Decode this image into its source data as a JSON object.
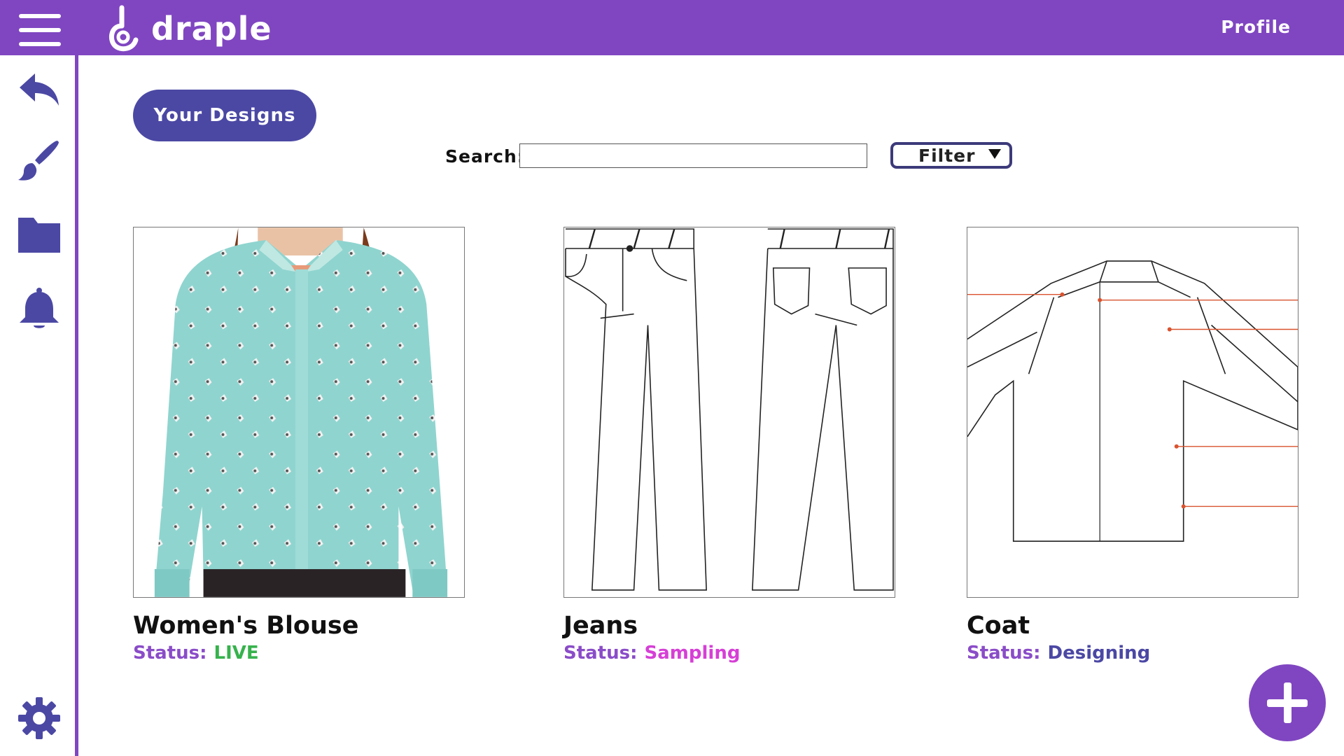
{
  "app": {
    "logo_text": "draple",
    "profile_label": "Profile"
  },
  "colors": {
    "brand": "#8046c1",
    "button": "#4b48a4",
    "icon": "#4b48a4",
    "status_live": "#37b24d",
    "status_sampling": "#d63fd6",
    "status_designing": "#4b48a4"
  },
  "sidebar": {
    "icons": [
      "back-arrow-icon",
      "paintbrush-icon",
      "folder-icon",
      "bell-icon",
      "gear-icon"
    ]
  },
  "main": {
    "section_button": "Your Designs",
    "search_label": "Search:",
    "search_value": "",
    "filter_label": "Filter"
  },
  "designs": [
    {
      "title": "Women's Blouse",
      "status_label": "Status:",
      "status": "LIVE",
      "image": "blouse-photo"
    },
    {
      "title": "Jeans",
      "status_label": "Status:",
      "status": "Sampling",
      "image": "jeans-flat-sketch"
    },
    {
      "title": "Coat",
      "status_label": "Status:",
      "status": "Designing",
      "image": "coat-flat-sketch"
    }
  ],
  "fab": {
    "icon": "plus-icon"
  }
}
